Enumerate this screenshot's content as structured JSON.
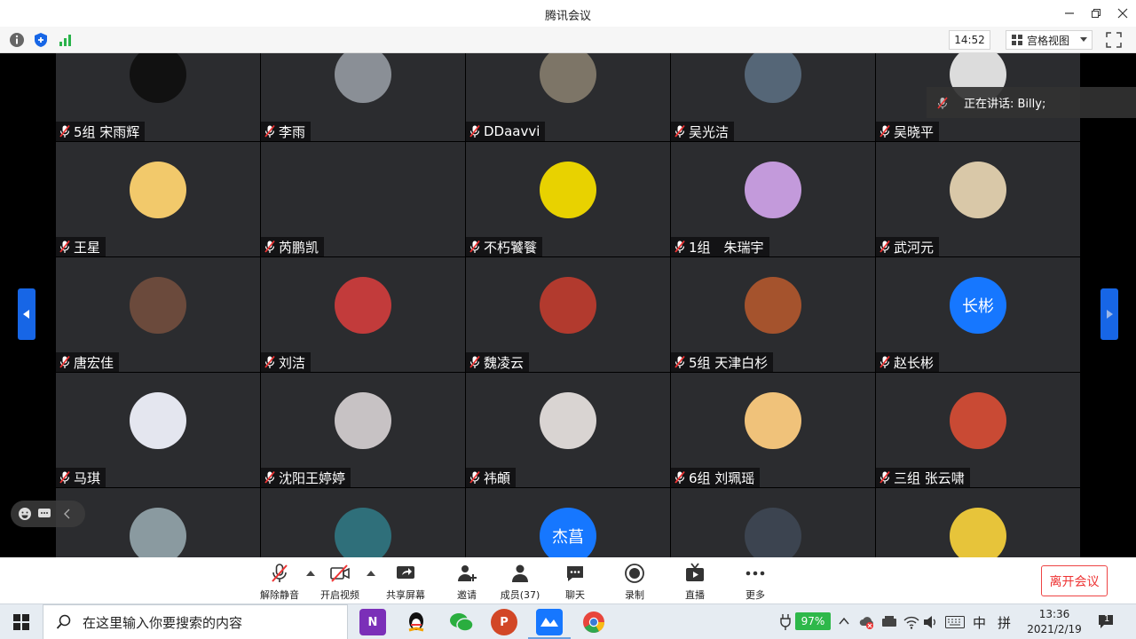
{
  "window": {
    "title": "腾讯会议"
  },
  "toolbar": {
    "time": "14:52",
    "view_label": "宫格视图"
  },
  "speaking": {
    "text": "正在讲话: Billy;"
  },
  "participants": [
    {
      "name": "5组 宋雨辉",
      "avatar_color": "#111",
      "avatar_text": ""
    },
    {
      "name": "李雨",
      "avatar_color": "#8a8f96",
      "avatar_text": ""
    },
    {
      "name": "DDaavvi",
      "avatar_color": "#7d7567",
      "avatar_text": ""
    },
    {
      "name": "吴光洁",
      "avatar_color": "#556677",
      "avatar_text": ""
    },
    {
      "name": "吴晓平",
      "avatar_color": "#dcdcdc",
      "avatar_text": ""
    },
    {
      "name": "王星",
      "avatar_color": "#f2c96b",
      "avatar_text": ""
    },
    {
      "name": "芮鹏凯",
      "avatar_color": "",
      "avatar_text": ""
    },
    {
      "name": "不朽饕餮",
      "avatar_color": "#e8d200",
      "avatar_text": ""
    },
    {
      "name": "1组　朱瑞宇",
      "avatar_color": "#c39adb",
      "avatar_text": ""
    },
    {
      "name": "武河元",
      "avatar_color": "#d9c8a8",
      "avatar_text": ""
    },
    {
      "name": "唐宏佳",
      "avatar_color": "#6b4a3c",
      "avatar_text": ""
    },
    {
      "name": "刘洁",
      "avatar_color": "#c23b3b",
      "avatar_text": ""
    },
    {
      "name": "魏凌云",
      "avatar_color": "#b23a2e",
      "avatar_text": ""
    },
    {
      "name": "5组 天津白杉",
      "avatar_color": "#a5532d",
      "avatar_text": ""
    },
    {
      "name": "赵长彬",
      "avatar_color": "#1677ff",
      "avatar_text": "长彬"
    },
    {
      "name": "马琪",
      "avatar_color": "#e4e6ef",
      "avatar_text": ""
    },
    {
      "name": "沈阳王婷婷",
      "avatar_color": "#c7c2c4",
      "avatar_text": ""
    },
    {
      "name": "祎頔",
      "avatar_color": "#d9d4d2",
      "avatar_text": ""
    },
    {
      "name": "6组 刘珮瑶",
      "avatar_color": "#f0c27a",
      "avatar_text": ""
    },
    {
      "name": "三组 张云啸",
      "avatar_color": "#c94a34",
      "avatar_text": ""
    },
    {
      "name": "",
      "avatar_color": "#8a9aa0",
      "avatar_text": ""
    },
    {
      "name": "",
      "avatar_color": "#2f6f7a",
      "avatar_text": ""
    },
    {
      "name": "",
      "avatar_color": "#1677ff",
      "avatar_text": "杰菖"
    },
    {
      "name": "",
      "avatar_color": "#3c4450",
      "avatar_text": ""
    },
    {
      "name": "",
      "avatar_color": "#e7c43a",
      "avatar_text": ""
    }
  ],
  "controls": {
    "unmute": "解除静音",
    "start_video": "开启视频",
    "share_screen": "共享屏幕",
    "invite": "邀请",
    "members": "成员(37)",
    "chat": "聊天",
    "record": "录制",
    "live": "直播",
    "more": "更多",
    "leave": "离开会议"
  },
  "taskbar": {
    "search_placeholder": "在这里输入你要搜索的内容",
    "battery": "97%",
    "ime_lang": "中",
    "ime_mode": "拼",
    "time": "13:36",
    "date": "2021/2/19",
    "notification_count": "1"
  },
  "colors": {
    "accent": "#1766e6",
    "leave": "#e33",
    "tile_bg": "#2b2c2f"
  }
}
